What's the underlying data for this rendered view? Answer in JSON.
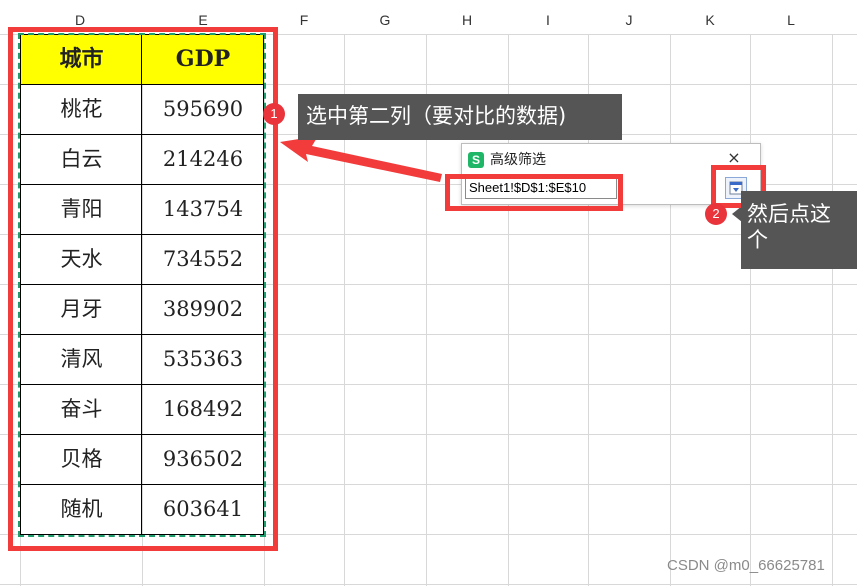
{
  "column_headers": [
    "D",
    "E",
    "F",
    "G",
    "H",
    "I",
    "J",
    "K",
    "L"
  ],
  "table": {
    "headers": [
      "城市",
      "GDP"
    ],
    "rows": [
      [
        "桃花",
        "595690"
      ],
      [
        "白云",
        "214246"
      ],
      [
        "青阳",
        "143754"
      ],
      [
        "天水",
        "734552"
      ],
      [
        "月牙",
        "389902"
      ],
      [
        "清风",
        "535363"
      ],
      [
        "奋斗",
        "168492"
      ],
      [
        "贝格",
        "936502"
      ],
      [
        "随机",
        "603641"
      ]
    ]
  },
  "annotations": {
    "step1": {
      "number": "1",
      "text": "选中第二列（要对比的数据)"
    },
    "step2": {
      "number": "2",
      "text": "然后点这个"
    }
  },
  "dialog": {
    "title": "高级筛选",
    "logo": "S",
    "range_value": "Sheet1!$D$1:$E$10",
    "close_glyph": "×",
    "collapse_button_icon": "collapse-dialog-icon"
  },
  "watermark": "CSDN @m0_66625781",
  "colors": {
    "header_fill": "#ffff00",
    "highlight_red": "#f23b3b",
    "marquee_green": "#1f9e6e",
    "callout_bg": "#555555",
    "badge_red": "#e8343a"
  }
}
